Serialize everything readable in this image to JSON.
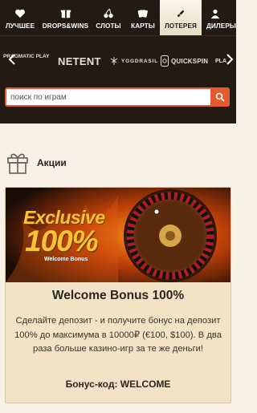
{
  "nav": {
    "items": [
      {
        "label": "ЛУЧШЕЕ",
        "icon": "heart-icon"
      },
      {
        "label": "DROPS&WINS",
        "icon": "drops-icon"
      },
      {
        "label": "СЛОТЫ",
        "icon": "cherry-icon"
      },
      {
        "label": "КАРТЫ",
        "icon": "cards-icon"
      },
      {
        "label": "ЛОТЕРЕЯ",
        "icon": "lottery-icon"
      },
      {
        "label": "ДИЛЕРЫ",
        "icon": "dealer-icon"
      }
    ],
    "active_index": 4
  },
  "providers": {
    "items": [
      "PRAGMATIC PLAY",
      "NETENT",
      "YGGDRASIL",
      "QUICKSPIN",
      "PLAY'N GO"
    ]
  },
  "search": {
    "placeholder": "поиск по играм"
  },
  "section": {
    "title": "Акции"
  },
  "promo": {
    "banner_line1": "Exclusive",
    "banner_line2": "100%",
    "banner_line3": "Welcome Bonus",
    "title": "Welcome Bonus 100%",
    "description": "Сделайте депозит - и получите бонус на депозит 100% до максимума в 10000₽ (€100, $100). В два раза больше казино-игр за те же деньги!",
    "bonus_code": "Бонус-код: WELCOME"
  },
  "colors": {
    "header_bg": "#231a14",
    "accent": "#e45a2c",
    "card_bg": "#f1e3c4",
    "page_bg": "#f7f1e6"
  }
}
